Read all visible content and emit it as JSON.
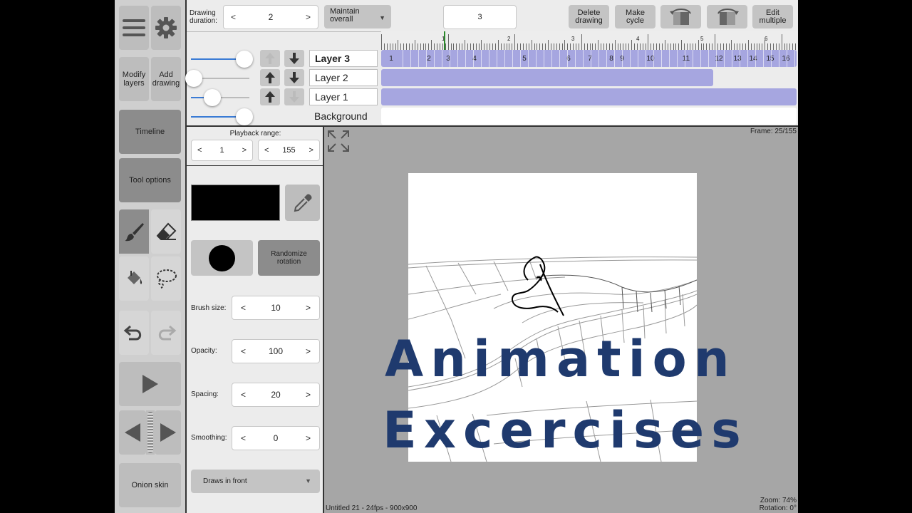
{
  "left_toolbar": {
    "menu_icon": "hamburger-icon",
    "settings_icon": "gear-icon",
    "modify_layers_label": "Modify layers",
    "add_drawing_label": "Add drawing",
    "timeline_label": "Timeline",
    "tool_options_label": "Tool options",
    "brush_icon": "brush-icon",
    "eraser_icon": "eraser-icon",
    "fill_icon": "paint-bucket-icon",
    "lasso_icon": "lasso-icon",
    "undo_icon": "undo-icon",
    "redo_icon": "redo-icon",
    "play_icon": "play-icon",
    "onion_skin_label": "Onion skin"
  },
  "top_bar": {
    "drawing_duration_label": "Drawing duration:",
    "drawing_duration_value": "2",
    "prev_arrow": "<",
    "next_arrow": ">",
    "maintain_label": "Maintain overall",
    "current_value": "3",
    "delete_drawing_label": "Delete drawing",
    "make_cycle_label": "Make cycle",
    "edit_multiple_label": "Edit multiple"
  },
  "ruler_labels": [
    "1",
    "2",
    "3",
    "4",
    "5",
    "6"
  ],
  "layers": [
    {
      "name": "Layer 3",
      "opacity": 0.87
    },
    {
      "name": "Layer 2",
      "opacity": 0.0
    },
    {
      "name": "Layer 1",
      "opacity": 0.32
    },
    {
      "name": "Background",
      "opacity": 0.87
    }
  ],
  "layer3_cells": [
    "1",
    "2",
    "3",
    "4",
    "5",
    "6",
    "7",
    "8",
    "9",
    "10",
    "11",
    "12",
    "13",
    "14",
    "15",
    "16"
  ],
  "tool_options": {
    "playback_range_label": "Playback range:",
    "range_start": "1",
    "range_end": "155",
    "randomize_rotation_label": "Randomize rotation",
    "brush_size_label": "Brush size:",
    "brush_size_value": "10",
    "opacity_label": "Opacity:",
    "opacity_value": "100",
    "spacing_label": "Spacing:",
    "spacing_value": "20",
    "smoothing_label": "Smoothing:",
    "smoothing_value": "0",
    "draw_mode": "Draws in front",
    "color_swatch": "#000000"
  },
  "canvas": {
    "frame_text": "Frame: 25/155",
    "doc_info": "Untitled 21 - 24fps - 900x900",
    "zoom_text": "Zoom: 74%",
    "rotation_text": "Rotation: 0°",
    "overlay_line1": "Animation",
    "overlay_line2": "Excercises"
  },
  "colors": {
    "cell_fill": "#a6a6e0",
    "accent": "#3a7bd5",
    "title": "#1f3a6e"
  }
}
